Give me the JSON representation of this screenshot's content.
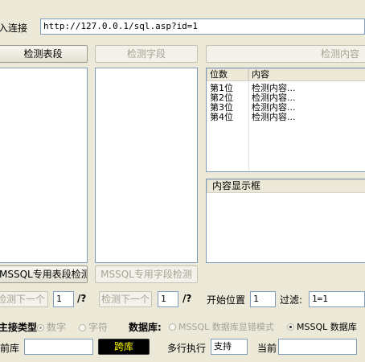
{
  "url_bar": {
    "label": "入连接",
    "value": "http://127.0.0.1/sql.asp?id=1"
  },
  "buttons": {
    "detect_tables": "检测表段",
    "detect_fields": "检测字段",
    "detect_content": "检测内容",
    "mssql_tables": "MSSQL专用表段检测",
    "mssql_fields": "MSSQL专用字段检测",
    "next_tables": "检测下一个",
    "next_fields": "检测下一个",
    "cross_db": "跨库"
  },
  "content_list": {
    "col_position": "位数",
    "col_content": "内容",
    "rows": [
      {
        "position": "第1位",
        "content": "检测内容..."
      },
      {
        "position": "第2位",
        "content": "检测内容..."
      },
      {
        "position": "第3位",
        "content": "检测内容..."
      },
      {
        "position": "第4位",
        "content": "检测内容..."
      }
    ]
  },
  "display_box": {
    "title": "内容显示框"
  },
  "pager_tables": {
    "value": "1",
    "suffix": "/?"
  },
  "pager_fields": {
    "value": "1",
    "suffix": "/?"
  },
  "start_position": {
    "label": "开始位置",
    "value": "1"
  },
  "filter": {
    "label": "过滤:",
    "value": "1=1"
  },
  "inject_type": {
    "label": "主接类型",
    "options": [
      "数字",
      "字符"
    ],
    "selected": "数字"
  },
  "database": {
    "label": "数据库:",
    "option_error": "MSSQL 数据库显错模式",
    "option_mssql": "MSSQL 数据库"
  },
  "current_db": {
    "label": "前库",
    "value": ""
  },
  "multiline_exec": {
    "label": "多行执行",
    "value": "支持"
  },
  "current_label": "当前"
}
